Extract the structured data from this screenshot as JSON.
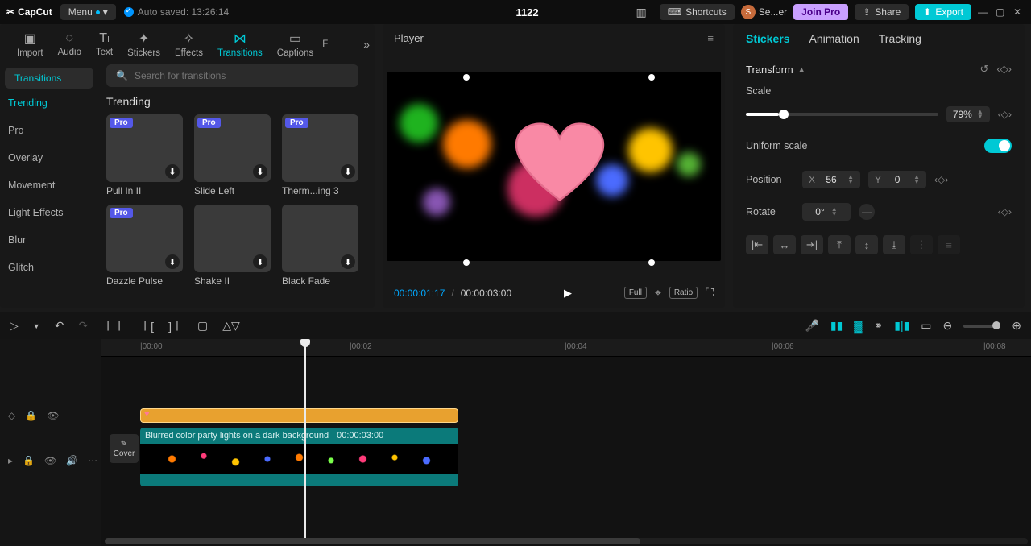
{
  "titlebar": {
    "app": "CapCut",
    "menu": "Menu",
    "autosave": "Auto saved: 13:26:14",
    "projectName": "1122",
    "shortcuts": "Shortcuts",
    "user": "Se...er",
    "joinPro": "Join Pro",
    "share": "Share",
    "export": "Export"
  },
  "topTabs": {
    "import": "Import",
    "audio": "Audio",
    "text": "Text",
    "stickers": "Stickers",
    "effects": "Effects",
    "transitions": "Transitions",
    "captions": "Captions",
    "more": "F"
  },
  "sidebar": {
    "pill": "Transitions",
    "items": [
      "Trending",
      "Pro",
      "Overlay",
      "Movement",
      "Light Effects",
      "Blur",
      "Glitch"
    ]
  },
  "browse": {
    "searchPlaceholder": "Search for transitions",
    "section": "Trending",
    "items": [
      {
        "label": "Pull In II",
        "pro": true
      },
      {
        "label": "Slide Left",
        "pro": true
      },
      {
        "label": "Therm...ing 3",
        "pro": true
      },
      {
        "label": "Dazzle Pulse",
        "pro": true
      },
      {
        "label": "Shake II",
        "pro": false
      },
      {
        "label": "Black Fade",
        "pro": false
      }
    ]
  },
  "player": {
    "title": "Player",
    "current": "00:00:01:17",
    "duration": "00:00:03:00",
    "full": "Full",
    "ratio": "Ratio"
  },
  "inspector": {
    "tabs": {
      "stickers": "Stickers",
      "animation": "Animation",
      "tracking": "Tracking"
    },
    "transform": "Transform",
    "scaleLabel": "Scale",
    "scaleValue": "79%",
    "uniform": "Uniform scale",
    "positionLabel": "Position",
    "posX": "56",
    "posY": "0",
    "rotateLabel": "Rotate",
    "rotateValue": "0°"
  },
  "timeline": {
    "ruler": [
      "|00:00",
      "|00:02",
      "|00:04",
      "|00:06",
      "|00:08"
    ],
    "coverLabel": "Cover",
    "clipTitle": "Blurred color party lights on a dark background",
    "clipDuration": "00:00:03:00"
  }
}
